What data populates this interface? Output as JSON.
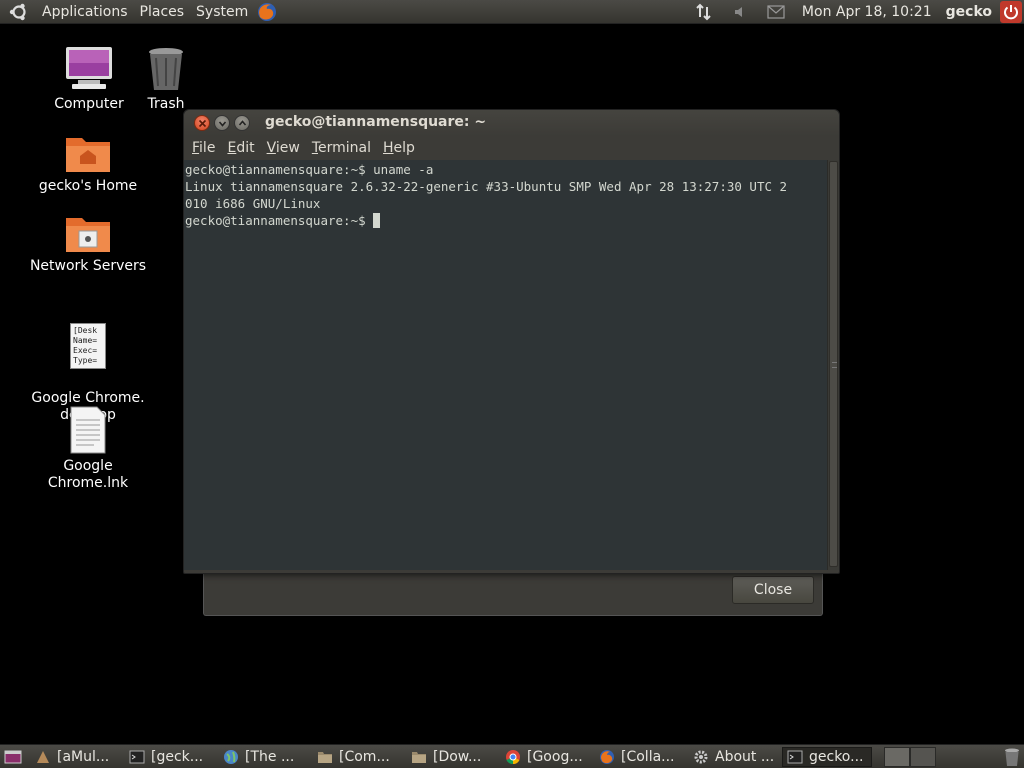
{
  "top_panel": {
    "menu": [
      "Applications",
      "Places",
      "System"
    ],
    "clock": "Mon Apr 18, 10:21",
    "username": "gecko"
  },
  "desktop_icons": [
    {
      "label": "Computer"
    },
    {
      "label": "Trash"
    },
    {
      "label": "gecko's Home"
    },
    {
      "label": "Network Servers"
    },
    {
      "label": "Google Chrome.\ndesktop",
      "file_preview": "[Desk\nName=\nExec=\nType="
    },
    {
      "label": "Google Chrome.lnk"
    }
  ],
  "terminal": {
    "title": "gecko@tiannamensquare: ~",
    "menu": [
      {
        "label": "File",
        "u": "F",
        "rest": "ile"
      },
      {
        "label": "Edit",
        "u": "E",
        "rest": "dit"
      },
      {
        "label": "View",
        "u": "V",
        "rest": "iew"
      },
      {
        "label": "Terminal",
        "u": "T",
        "rest": "erminal"
      },
      {
        "label": "Help",
        "u": "H",
        "rest": "elp"
      }
    ],
    "lines": [
      "gecko@tiannamensquare:~$ uname -a",
      "Linux tiannamensquare 2.6.32-22-generic #33-Ubuntu SMP Wed Apr 28 13:27:30 UTC 2",
      "010 i686 GNU/Linux"
    ],
    "prompt": "gecko@tiannamensquare:~$ "
  },
  "dialog": {
    "close_label": "Close"
  },
  "taskbar": {
    "tasks": [
      {
        "label": "[aMul...",
        "icon": "amule-icon"
      },
      {
        "label": "[geck...",
        "icon": "terminal-icon"
      },
      {
        "label": "[The ...",
        "icon": "globe-icon"
      },
      {
        "label": "[Com...",
        "icon": "folder-icon"
      },
      {
        "label": "[Dow...",
        "icon": "folder-icon"
      },
      {
        "label": "[Goog...",
        "icon": "chrome-icon"
      },
      {
        "label": "[Colla...",
        "icon": "firefox-icon"
      },
      {
        "label": "About ...",
        "icon": "gear-icon"
      },
      {
        "label": "gecko...",
        "icon": "terminal-icon",
        "active": true
      }
    ]
  }
}
